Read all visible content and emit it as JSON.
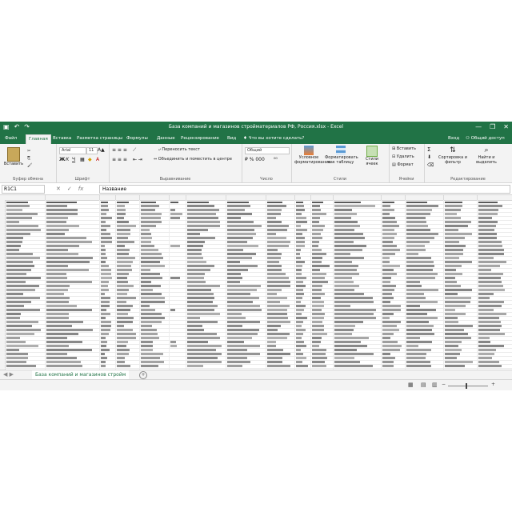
{
  "titlebar": {
    "title": "База компаний и магазинов стройматериалов РФ, Россия.xlsx - Excel",
    "save_icon": "save-icon",
    "undo_icon": "undo-icon",
    "redo_icon": "redo-icon",
    "minimize": "—",
    "restore": "❐",
    "close": "✕"
  },
  "tabs": [
    "Файл",
    "Главная",
    "Вставка",
    "Разметка страницы",
    "Формулы",
    "Данные",
    "Рецензирование",
    "Вид"
  ],
  "active_tab": "Главная",
  "tell_me": "Что вы хотите сделать?",
  "signin": "Вход",
  "share": "Общий доступ",
  "ribbon": {
    "paste": "Вставить",
    "font_name": "Arial",
    "font_size": "11",
    "bold": "Ж",
    "italic": "К",
    "underline": "Ч",
    "wrap_text": "Переносить текст",
    "merge": "Объединить и поместить в центре",
    "number_format": "Общий",
    "cond_format": "Условное форматирование",
    "format_table": "Форматировать как таблицу",
    "cell_styles": "Стили ячеек",
    "insert": "Вставить",
    "delete": "Удалить",
    "format": "Формат",
    "sort": "Сортировка и фильтр",
    "find": "Найти и выделить",
    "groups": {
      "clipboard": "Буфер обмена",
      "font": "Шрифт",
      "alignment": "Выравнивание",
      "number": "Число",
      "styles": "Стили",
      "cells": "Ячейки",
      "editing": "Редактирование"
    }
  },
  "formula": {
    "name_box": "R1C1",
    "fx": "fx",
    "value": "Название"
  },
  "sheet": {
    "tab_name": "База компаний и магазинов стройм",
    "add": "+"
  },
  "status": {
    "zoom_minus": "−",
    "zoom_plus": "+"
  }
}
